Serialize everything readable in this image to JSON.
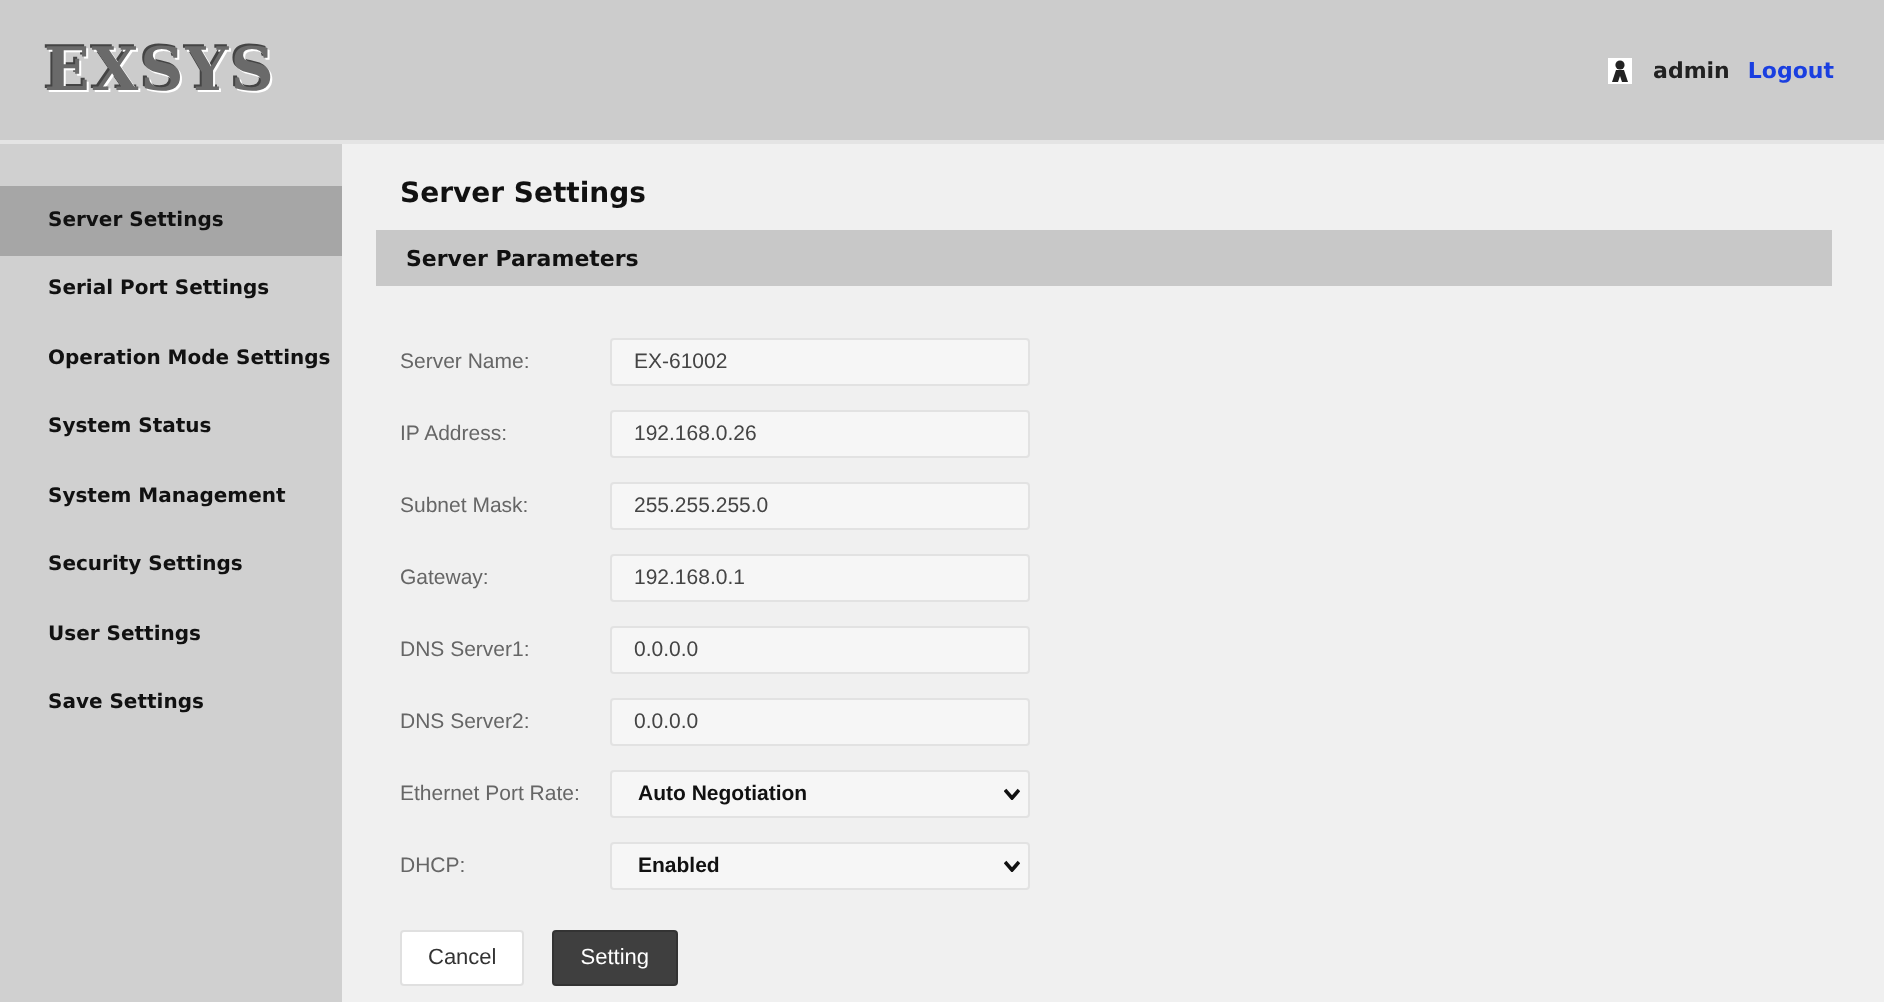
{
  "header": {
    "logo": "EXSYS",
    "user": "admin",
    "logout": "Logout"
  },
  "sidebar": {
    "items": [
      {
        "label": "Server Settings",
        "selected": true
      },
      {
        "label": "Serial Port Settings",
        "selected": false
      },
      {
        "label": "Operation Mode Settings",
        "selected": false
      },
      {
        "label": "System Status",
        "selected": false
      },
      {
        "label": "System Management",
        "selected": false
      },
      {
        "label": "Security Settings",
        "selected": false
      },
      {
        "label": "User Settings",
        "selected": false
      },
      {
        "label": "Save Settings",
        "selected": false
      }
    ]
  },
  "page_title": "Server Settings",
  "section": "Server Parameters",
  "fields": [
    {
      "label": "Server Name:",
      "kind": "text",
      "value": "EX-61002"
    },
    {
      "label": "IP Address:",
      "kind": "text",
      "value": "192.168.0.26"
    },
    {
      "label": "Subnet Mask:",
      "kind": "text",
      "value": "255.255.255.0"
    },
    {
      "label": "Gateway:",
      "kind": "text",
      "value": "192.168.0.1"
    },
    {
      "label": "DNS Server1:",
      "kind": "text",
      "value": "0.0.0.0"
    },
    {
      "label": "DNS Server2:",
      "kind": "text",
      "value": "0.0.0.0"
    },
    {
      "label": "Ethernet Port Rate:",
      "kind": "select",
      "value": "Auto Negotiation"
    },
    {
      "label": "DHCP:",
      "kind": "select",
      "value": "Enabled"
    }
  ],
  "buttons": [
    {
      "label": "Cancel",
      "kind": "secondary"
    },
    {
      "label": "Setting",
      "kind": "primary"
    }
  ]
}
